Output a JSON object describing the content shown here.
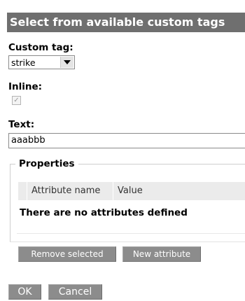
{
  "dialog": {
    "title": "Select from available custom tags"
  },
  "custom_tag": {
    "label": "Custom tag:",
    "selected": "strike"
  },
  "inline": {
    "label": "Inline:",
    "checked": true
  },
  "text": {
    "label": "Text:",
    "value": "aaabbb"
  },
  "properties": {
    "legend": "Properties",
    "columns": [
      "Attribute name",
      "Value"
    ],
    "empty_message": "There are no attributes defined",
    "remove_label": "Remove selected",
    "new_label": "New attribute"
  },
  "footer": {
    "ok_label": "OK",
    "cancel_label": "Cancel"
  },
  "colors": {
    "title_bar": "#6f6f6f",
    "button": "#8c8c8c",
    "table_header": "#ebebeb"
  }
}
